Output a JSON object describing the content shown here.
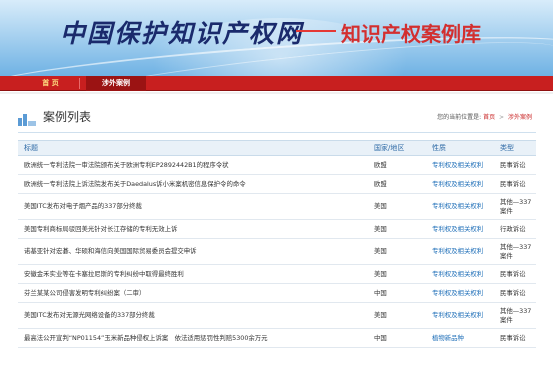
{
  "header": {
    "site_title": "中国保护知识产权网",
    "dash": "——",
    "sub_title": "知识产权案例库"
  },
  "nav": {
    "items": [
      {
        "label": "首 页"
      },
      {
        "label": "涉外案例"
      }
    ]
  },
  "section": {
    "title": "案例列表",
    "location_prefix": "您的当前位置是:",
    "breadcrumb": [
      "首页",
      "涉外案例"
    ],
    "breadcrumb_sep": ">"
  },
  "table": {
    "headers": [
      "标题",
      "国家/地区",
      "性质",
      "类型"
    ],
    "rows": [
      {
        "title": "欧洲统一专利法院一审法院颁布关于欧洲专利EP2892442B1的程序令状",
        "region": "欧盟",
        "nature": "专利权及相关权利",
        "type": "民事诉讼"
      },
      {
        "title": "欧洲统一专利法院上诉法院发布关于Daedalus诉小米案机密信息保护令的命令",
        "region": "欧盟",
        "nature": "专利权及相关权利",
        "type": "民事诉讼"
      },
      {
        "title": "美国ITC发布对电子烟产品的337部分终裁",
        "region": "美国",
        "nature": "专利权及相关权利",
        "type": "其他—337案件"
      },
      {
        "title": "美国专利商标局驳回美光针对长江存储的专利无效上诉",
        "region": "美国",
        "nature": "专利权及相关权利",
        "type": "行政诉讼"
      },
      {
        "title": "诺基亚针对宏碁、华硕和海信向美国国际贸易委员会提交申诉",
        "region": "美国",
        "nature": "专利权及相关权利",
        "type": "其他—337案件"
      },
      {
        "title": "安徽金禾实业等在卡塞拉尼斯的专利纠纷中取得最终胜利",
        "region": "美国",
        "nature": "专利权及相关权利",
        "type": "民事诉讼"
      },
      {
        "title": "芬兰某某公司侵害发明专利纠纷案（二审）",
        "region": "中国",
        "nature": "专利权及相关权利",
        "type": "民事诉讼"
      },
      {
        "title": "美国ITC发布对无源光网络设备的337部分终裁",
        "region": "美国",
        "nature": "专利权及相关权利",
        "type": "其他—337案件"
      },
      {
        "title": "最高法公开宣判“NP01154”玉米新品种侵权上诉案　依法适用惩罚性判赔5300余万元",
        "region": "中国",
        "nature": "植物新品种",
        "type": "民事诉讼"
      }
    ]
  },
  "colors": {
    "nav_red": "#c81f1f",
    "link_blue": "#1f6fb8",
    "subtitle_red": "#d32f2f",
    "title_navy": "#1a2a6c"
  }
}
